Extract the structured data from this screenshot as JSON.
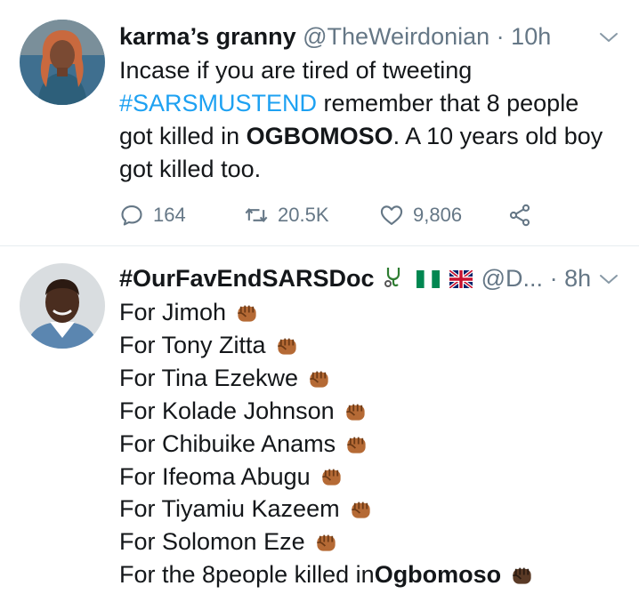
{
  "tweet1": {
    "display_name": "karma’s granny",
    "handle": "@TheWeirdonian",
    "separator": "·",
    "time": "10h",
    "text_line1": "Incase if you are tired of tweeting",
    "hashtag": "#SARSMUSTEND",
    "text_line2_rest": " remember that 8 people",
    "text_line3_pre": "got killed in ",
    "text_line3_bold": "OGBOMOSO",
    "text_line3_post": ". A 10 years old boy",
    "text_line4": "got killed too.",
    "replies": "164",
    "retweets": "20.5K",
    "likes": "9,806",
    "icons": [
      "chevron-down-icon",
      "reply-icon",
      "retweet-icon",
      "like-icon",
      "share-icon"
    ]
  },
  "tweet2": {
    "display_name": "#OurFavEndSARSDoc",
    "handle": "@D...",
    "separator": "·",
    "time": "8h",
    "lines": [
      "For Jimoh",
      "For Tony Zitta",
      "For Tina Ezekwe",
      "For Kolade Johnson",
      "For Chibuike Anams",
      "For Ifeoma Abugu",
      "For Tiyamiu Kazeem",
      "For Solomon Eze"
    ],
    "last_line_pre": "For the 8people killed in ",
    "last_line_bold": "Ogbomoso",
    "icons": [
      "stethoscope-icon",
      "nigeria-flag-icon",
      "uk-flag-icon",
      "raised-fist-icon",
      "chevron-down-icon"
    ]
  },
  "colors": {
    "link_blue": "#1da1f2",
    "secondary_gray": "#657786",
    "divider": "#e6ecf0",
    "text": "#14171a"
  }
}
